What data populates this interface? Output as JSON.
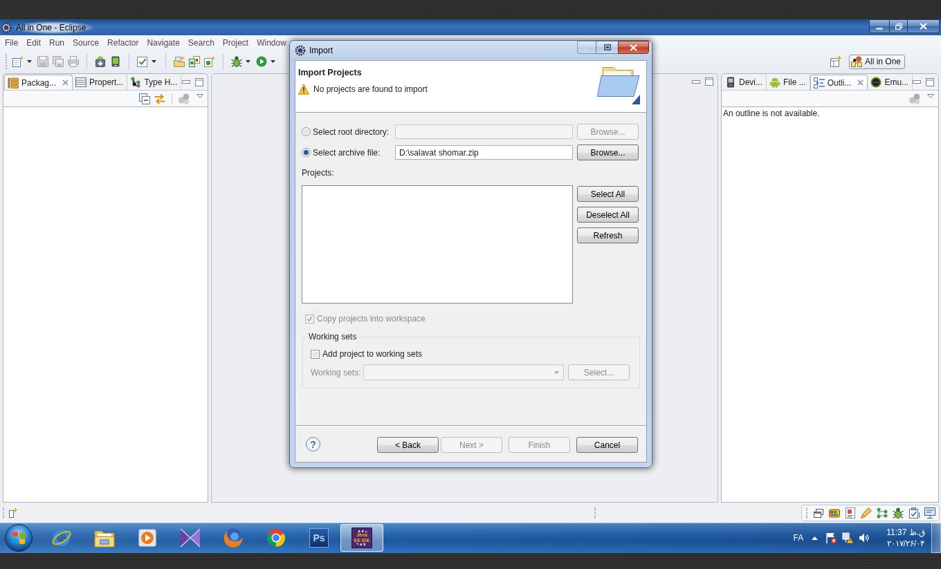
{
  "window": {
    "title": "All in One - Eclipse"
  },
  "menu": [
    "File",
    "Edit",
    "Run",
    "Source",
    "Refactor",
    "Navigate",
    "Search",
    "Project",
    "Window"
  ],
  "perspective": {
    "label": "All in One",
    "selected": true
  },
  "left_panel": {
    "tabs": [
      {
        "label": "Packag...",
        "kind": "package",
        "selected": true
      },
      {
        "label": "Propert...",
        "kind": "properties",
        "selected": false
      },
      {
        "label": "Type H...",
        "kind": "hierarchy",
        "selected": false
      }
    ]
  },
  "right_panel": {
    "tabs": [
      {
        "label": "Devi...",
        "kind": "device",
        "selected": false
      },
      {
        "label": "File ...",
        "kind": "android",
        "selected": false
      },
      {
        "label": "Outli...",
        "kind": "outline",
        "selected": true
      },
      {
        "label": "Emu...",
        "kind": "emulator",
        "selected": false
      }
    ],
    "message": "An outline is not available."
  },
  "dialog": {
    "title": "Import",
    "heading": "Import Projects",
    "message": "No projects are found to import",
    "sources": [
      {
        "label": "Select root directory:",
        "selected": false,
        "browse": {
          "label": "Browse...",
          "disabled": true
        }
      },
      {
        "label": "Select archive file:",
        "selected": true,
        "value": "D:\\salavat shomar.zip",
        "browse": {
          "label": "Browse...",
          "disabled": false
        }
      }
    ],
    "projects_label": "Projects:",
    "list_buttons": [
      {
        "label": "Select All",
        "disabled": false
      },
      {
        "label": "Deselect All",
        "disabled": false
      },
      {
        "label": "Refresh",
        "disabled": false
      }
    ],
    "copy_option": {
      "label": "Copy projects into workspace",
      "checked": true,
      "disabled": true
    },
    "working_sets": {
      "title": "Working sets",
      "add_option": {
        "label": "Add project to working sets",
        "checked": false
      },
      "field_label": "Working sets:",
      "select_button": {
        "label": "Select..."
      }
    },
    "help": "?",
    "buttons": [
      {
        "label": "< Back",
        "disabled": false
      },
      {
        "label": "Next >",
        "disabled": true
      },
      {
        "label": "Finish",
        "disabled": true
      },
      {
        "label": "Cancel",
        "disabled": false
      }
    ]
  },
  "taskbar": {
    "apps": [
      {
        "kind": "swoosh",
        "selected": false
      },
      {
        "kind": "folder",
        "selected": false
      },
      {
        "kind": "player",
        "selected": false
      },
      {
        "kind": "bowtie",
        "selected": false
      },
      {
        "kind": "globe",
        "selected": false
      },
      {
        "kind": "wheel",
        "selected": false
      },
      {
        "kind": "tile",
        "label": "Ps",
        "selected": false
      },
      {
        "kind": "geartile",
        "label": "Java EE IDE",
        "selected": true
      }
    ],
    "language": "FA",
    "time": "11:37 ق.ظ",
    "date": "۲۰۱۷/۲۶/۰۴"
  }
}
